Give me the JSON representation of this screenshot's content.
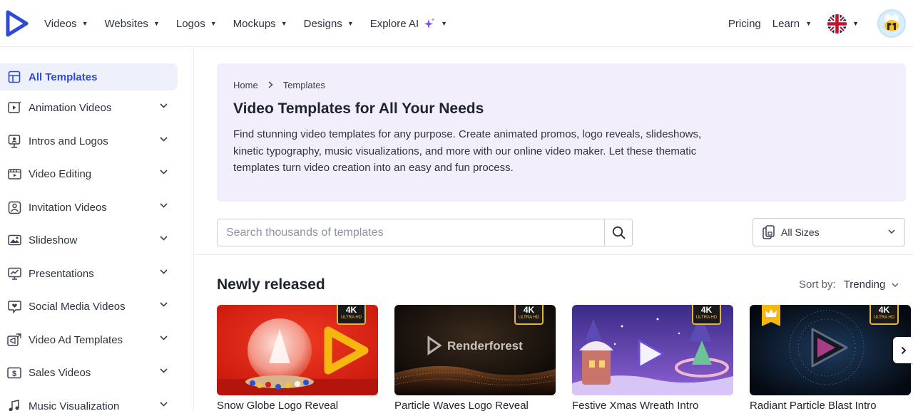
{
  "header": {
    "nav": [
      {
        "label": "Videos"
      },
      {
        "label": "Websites"
      },
      {
        "label": "Logos"
      },
      {
        "label": "Mockups"
      },
      {
        "label": "Designs"
      },
      {
        "label": "Explore AI"
      }
    ],
    "pricing": "Pricing",
    "learn": "Learn",
    "language_icon": "uk-flag-icon",
    "avatar_icon": "bee-avatar"
  },
  "sidebar": {
    "items": [
      {
        "label": "All Templates",
        "icon": "grid-icon",
        "active": true
      },
      {
        "label": "Animation Videos",
        "icon": "play-icon"
      },
      {
        "label": "Intros and Logos",
        "icon": "presenter-icon"
      },
      {
        "label": "Video Editing",
        "icon": "film-icon"
      },
      {
        "label": "Invitation Videos",
        "icon": "invitation-icon"
      },
      {
        "label": "Slideshow",
        "icon": "image-icon"
      },
      {
        "label": "Presentations",
        "icon": "chart-icon"
      },
      {
        "label": "Social Media Videos",
        "icon": "chat-heart-icon"
      },
      {
        "label": "Video Ad Templates",
        "icon": "megaphone-icon"
      },
      {
        "label": "Sales Videos",
        "icon": "dollar-icon"
      },
      {
        "label": "Music Visualization",
        "icon": "music-icon"
      }
    ]
  },
  "hero": {
    "breadcrumb": [
      "Home",
      "Templates"
    ],
    "title": "Video Templates for All Your Needs",
    "description": "Find stunning video templates for any purpose. Create animated promos, logo reveals, slideshows, kinetic typography, music visualizations, and more with our online video maker. Let these thematic templates turn video creation into an easy and fun process."
  },
  "search": {
    "placeholder": "Search thousands of templates",
    "value": ""
  },
  "sizes": {
    "label": "All Sizes"
  },
  "section": {
    "title": "Newly released",
    "sort_label": "Sort by:",
    "sort_value": "Trending"
  },
  "cards": [
    {
      "title": "Snow Globe Logo Reveal",
      "badge": "4K",
      "badge_sub": "ULTRA HD",
      "premium": false
    },
    {
      "title": "Particle Waves Logo Reveal",
      "badge": "4K",
      "badge_sub": "ULTRA HD",
      "premium": false,
      "thumb_text": "Renderforest"
    },
    {
      "title": "Festive Xmas Wreath Intro",
      "badge": "4K",
      "badge_sub": "ULTRA HD",
      "premium": false
    },
    {
      "title": "Radiant Particle Blast Intro",
      "badge": "4K",
      "badge_sub": "ULTRA HD",
      "premium": true
    }
  ],
  "colors": {
    "brand_blue": "#2e4bd7",
    "hero_bg": "#f3eefb",
    "badge_gold": "#e8b33a"
  }
}
